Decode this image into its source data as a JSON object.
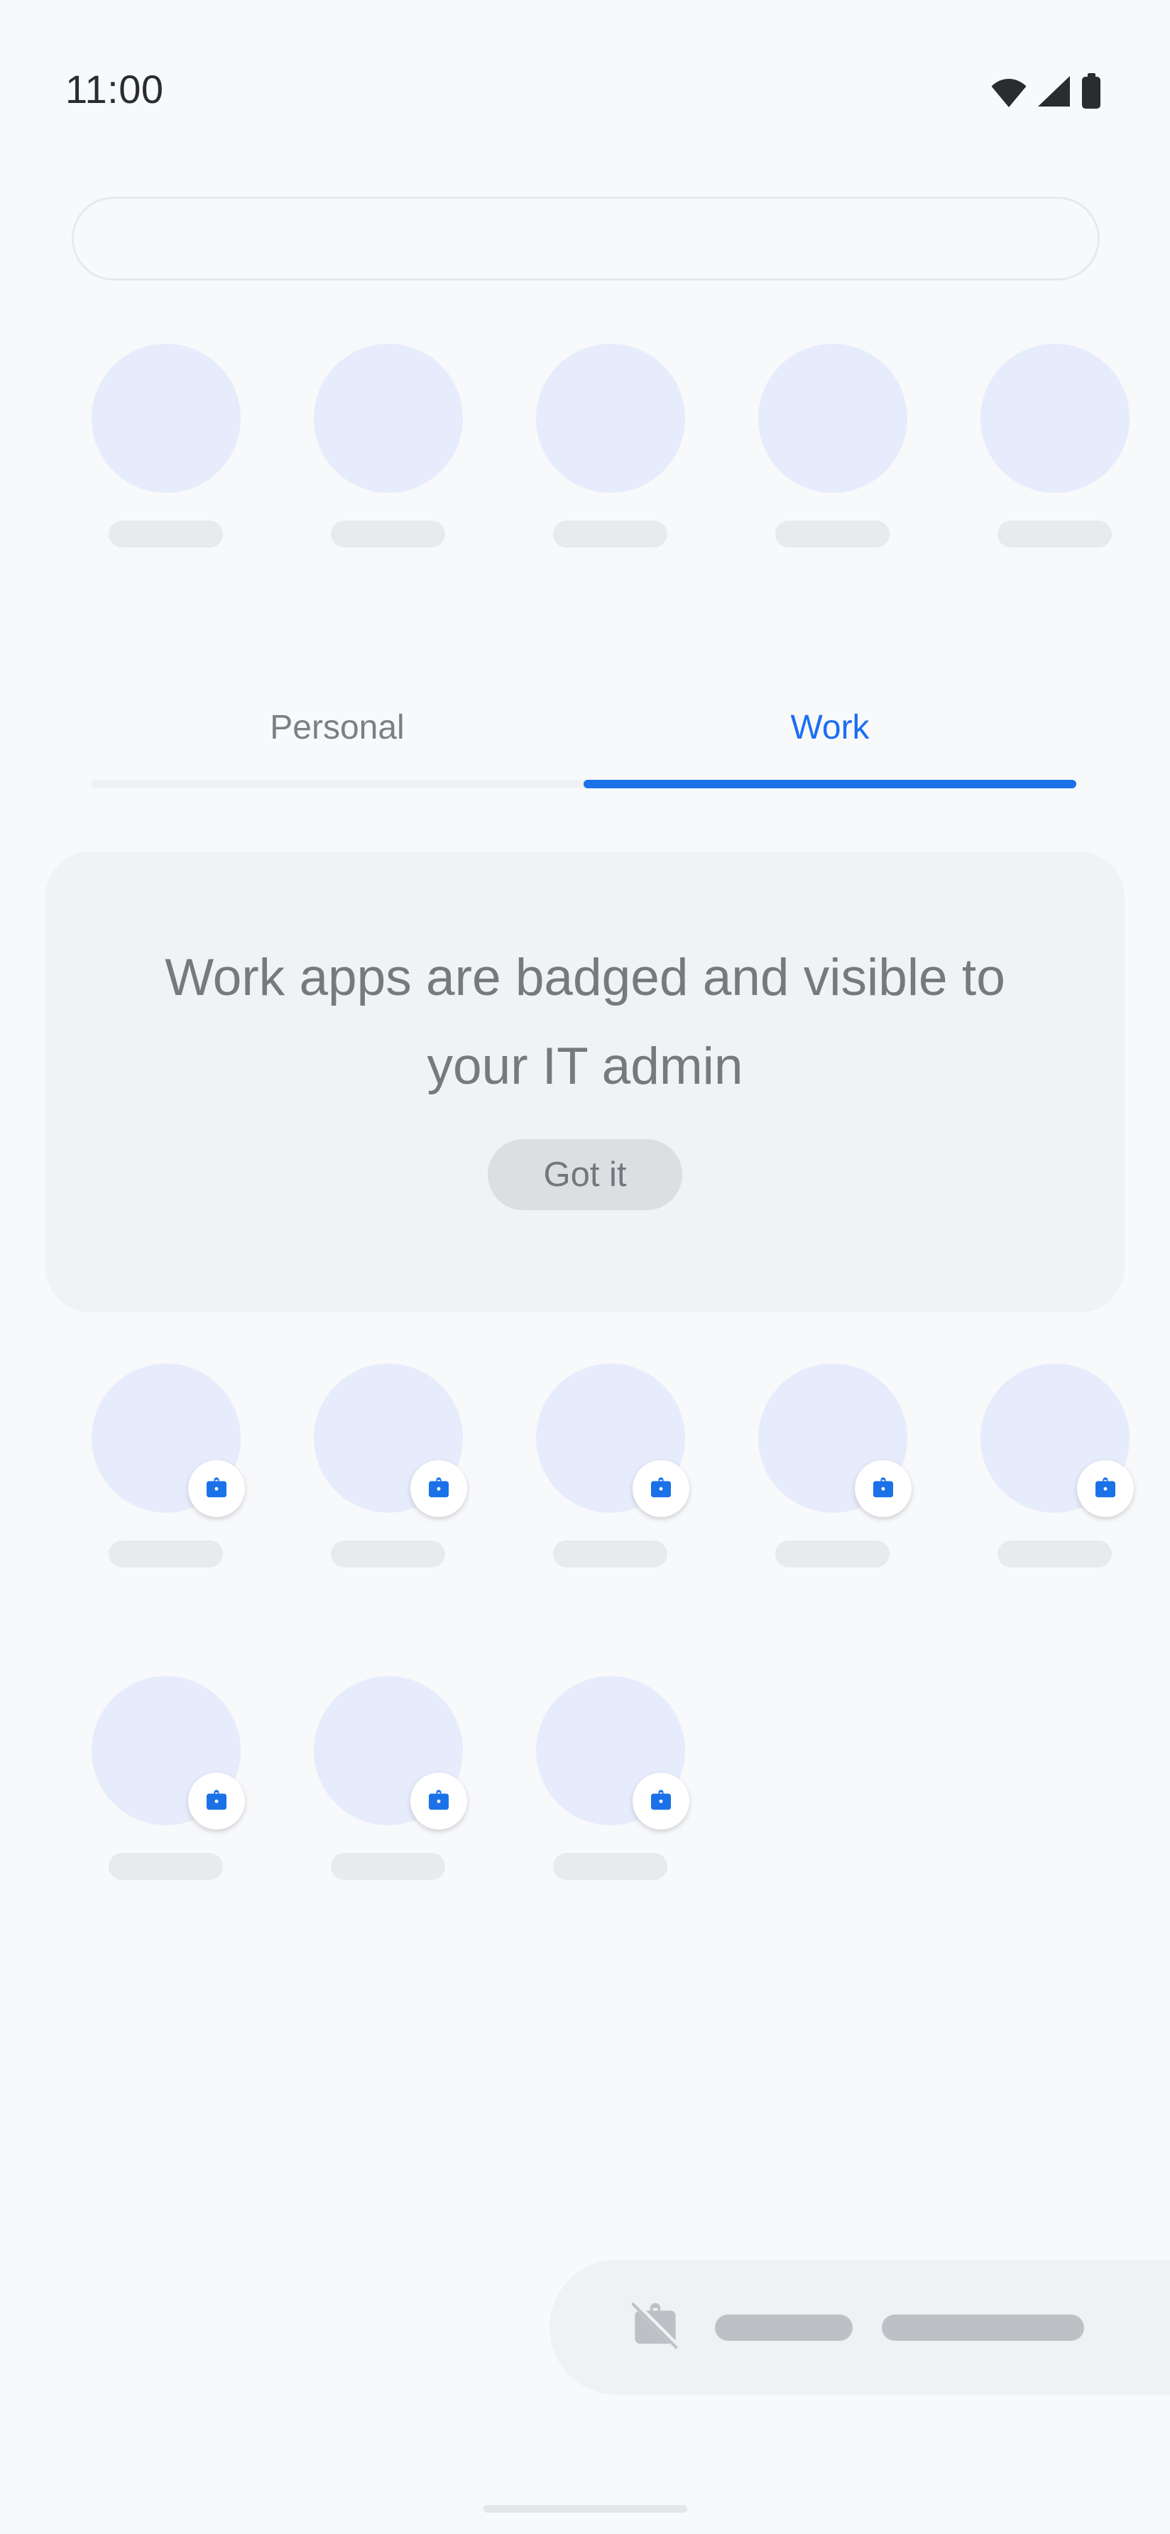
{
  "status_bar": {
    "time": "11:00",
    "icons": [
      "wifi-icon",
      "cellular-signal-icon",
      "battery-icon"
    ]
  },
  "search": {
    "value": "",
    "placeholder": ""
  },
  "top_apps": {
    "count": 5,
    "items": [
      {
        "icon": "app-icon-placeholder",
        "label": ""
      },
      {
        "icon": "app-icon-placeholder",
        "label": ""
      },
      {
        "icon": "app-icon-placeholder",
        "label": ""
      },
      {
        "icon": "app-icon-placeholder",
        "label": ""
      },
      {
        "icon": "app-icon-placeholder",
        "label": ""
      }
    ]
  },
  "tabs": {
    "personal_label": "Personal",
    "work_label": "Work",
    "selected": "Work",
    "active_color": "#1b6ef3",
    "inactive_color": "#7a8085",
    "indicator_color": "#1b72e8",
    "track_color": "#eff1f3"
  },
  "info_card": {
    "title": "Work apps are badged and visible to your IT admin",
    "button_label": "Got it",
    "background": "#f1f2f4",
    "text_color": "#76797e",
    "button_background": "#dcdee1"
  },
  "work_apps": {
    "badge_icon": "work-briefcase-badge-icon",
    "badge_color": "#1b72e8",
    "row1": [
      {
        "icon": "work-app-icon-placeholder",
        "label": ""
      },
      {
        "icon": "work-app-icon-placeholder",
        "label": ""
      },
      {
        "icon": "work-app-icon-placeholder",
        "label": ""
      },
      {
        "icon": "work-app-icon-placeholder",
        "label": ""
      },
      {
        "icon": "work-app-icon-placeholder",
        "label": ""
      }
    ],
    "row2": [
      {
        "icon": "work-app-icon-placeholder",
        "label": ""
      },
      {
        "icon": "work-app-icon-placeholder",
        "label": ""
      },
      {
        "icon": "work-app-icon-placeholder",
        "label": ""
      }
    ]
  },
  "work_toggle": {
    "icon": "work-off-briefcase-icon",
    "pill_small": "",
    "pill_large": "",
    "background": "#f0f1f3"
  },
  "theme": {
    "page_background": "#f8f9fb",
    "app_icon_fill": "#e6ecfb",
    "app_label_fill": "#e8eaed",
    "placeholder_gray": "#bdc1c6"
  },
  "gesture_bar": {
    "present": true
  }
}
